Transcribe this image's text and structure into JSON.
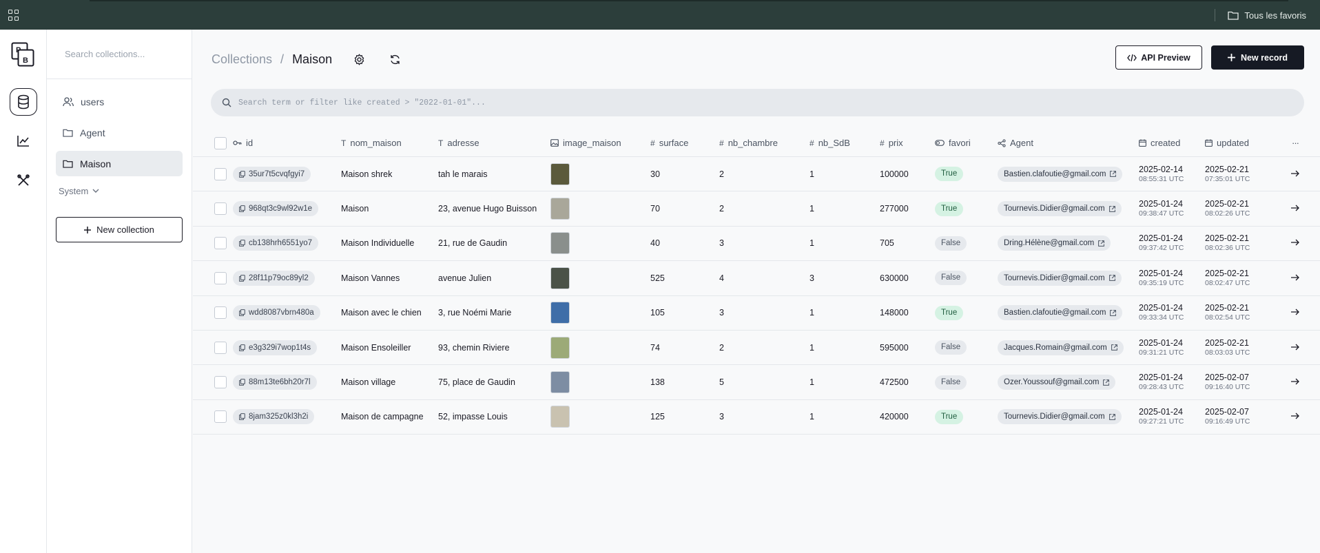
{
  "topbar": {
    "favorites_label": "Tous les favoris"
  },
  "rail": {
    "logo_text_top": "P",
    "logo_text_bottom": "B",
    "items": [
      "collections",
      "logs",
      "settings"
    ]
  },
  "sidebar": {
    "search_placeholder": "Search collections...",
    "collections": [
      {
        "label": "users",
        "icon": "users-icon"
      },
      {
        "label": "Agent",
        "icon": "folder-icon"
      },
      {
        "label": "Maison",
        "icon": "folder-icon",
        "active": true
      }
    ],
    "system_label": "System",
    "new_collection_label": "New collection"
  },
  "header": {
    "crumb_root": "Collections",
    "crumb_sep": "/",
    "crumb_current": "Maison",
    "api_preview_label": "API Preview",
    "new_record_label": "New record"
  },
  "filter": {
    "placeholder": "Search term or filter like created > \"2022-01-01\"..."
  },
  "table": {
    "columns": [
      "id",
      "nom_maison",
      "adresse",
      "image_maison",
      "surface",
      "nb_chambre",
      "nb_SdB",
      "prix",
      "favori",
      "Agent",
      "created",
      "updated"
    ],
    "more_label": "···",
    "rows": [
      {
        "id": "35ur7t5cvqfgyi7",
        "nom": "Maison shrek",
        "adresse": "tah le marais",
        "surface": "30",
        "nb_chambre": "2",
        "nb_sdb": "1",
        "prix": "100000",
        "favori": "True",
        "agent": "Bastien.clafoutie@gmail.com",
        "created_d": "2025-02-14",
        "created_t": "08:55:31 UTC",
        "updated_d": "2025-02-21",
        "updated_t": "07:35:01 UTC",
        "thumb": "#5b5a3c"
      },
      {
        "id": "968qt3c9wl92w1e",
        "nom": "Maison",
        "adresse": "23, avenue Hugo Buisson",
        "surface": "70",
        "nb_chambre": "2",
        "nb_sdb": "1",
        "prix": "277000",
        "favori": "True",
        "agent": "Tournevis.Didier@gmail.com",
        "created_d": "2025-01-24",
        "created_t": "09:38:47 UTC",
        "updated_d": "2025-02-21",
        "updated_t": "08:02:26 UTC",
        "thumb": "#a9a79a"
      },
      {
        "id": "cb138hrh6551yo7",
        "nom": "Maison Individuelle",
        "adresse": "21, rue de Gaudin",
        "surface": "40",
        "nb_chambre": "3",
        "nb_sdb": "1",
        "prix": "705",
        "favori": "False",
        "agent": "Dring.Hélène@gmail.com",
        "created_d": "2025-01-24",
        "created_t": "09:37:42 UTC",
        "updated_d": "2025-02-21",
        "updated_t": "08:02:36 UTC",
        "thumb": "#8a8f8c"
      },
      {
        "id": "28f11p79oc89yl2",
        "nom": "Maison Vannes",
        "adresse": "avenue Julien",
        "surface": "525",
        "nb_chambre": "4",
        "nb_sdb": "3",
        "prix": "630000",
        "favori": "False",
        "agent": "Tournevis.Didier@gmail.com",
        "created_d": "2025-01-24",
        "created_t": "09:35:19 UTC",
        "updated_d": "2025-02-21",
        "updated_t": "08:02:47 UTC",
        "thumb": "#4a5248"
      },
      {
        "id": "wdd8087vbrn480a",
        "nom": "Maison avec le chien",
        "adresse": "3, rue Noémi Marie",
        "surface": "105",
        "nb_chambre": "3",
        "nb_sdb": "1",
        "prix": "148000",
        "favori": "True",
        "agent": "Bastien.clafoutie@gmail.com",
        "created_d": "2025-01-24",
        "created_t": "09:33:34 UTC",
        "updated_d": "2025-02-21",
        "updated_t": "08:02:54 UTC",
        "thumb": "#3f6ea8"
      },
      {
        "id": "e3g329i7wop1t4s",
        "nom": "Maison Ensoleiller",
        "adresse": "93, chemin Riviere",
        "surface": "74",
        "nb_chambre": "2",
        "nb_sdb": "1",
        "prix": "595000",
        "favori": "False",
        "agent": "Jacques.Romain@gmail.com",
        "created_d": "2025-01-24",
        "created_t": "09:31:21 UTC",
        "updated_d": "2025-02-21",
        "updated_t": "08:03:03 UTC",
        "thumb": "#9caa78"
      },
      {
        "id": "88m13te6bh20r7l",
        "nom": "Maison village",
        "adresse": "75, place de Gaudin",
        "surface": "138",
        "nb_chambre": "5",
        "nb_sdb": "1",
        "prix": "472500",
        "favori": "False",
        "agent": "Ozer.Youssouf@gmail.com",
        "created_d": "2025-01-24",
        "created_t": "09:28:43 UTC",
        "updated_d": "2025-02-07",
        "updated_t": "09:16:40 UTC",
        "thumb": "#7d8da3"
      },
      {
        "id": "8jam325z0kl3h2i",
        "nom": "Maison de campagne",
        "adresse": "52, impasse Louis",
        "surface": "125",
        "nb_chambre": "3",
        "nb_sdb": "1",
        "prix": "420000",
        "favori": "True",
        "agent": "Tournevis.Didier@gmail.com",
        "created_d": "2025-01-24",
        "created_t": "09:27:21 UTC",
        "updated_d": "2025-02-07",
        "updated_t": "09:16:49 UTC",
        "thumb": "#c9c2b0"
      }
    ]
  }
}
